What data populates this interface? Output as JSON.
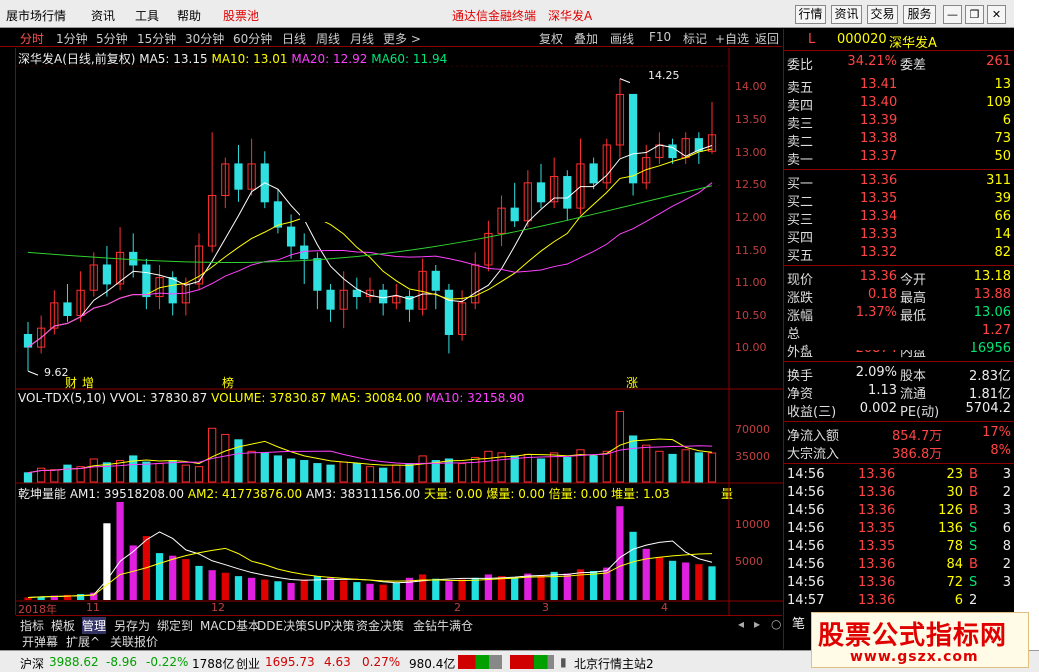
{
  "menubar": {
    "items": [
      "展市场行情",
      "资讯",
      "工具",
      "帮助",
      "股票池"
    ],
    "center_title": "通达信金融终端",
    "stock_title": "深华发A",
    "right_buttons": [
      "行情",
      "资讯",
      "交易",
      "服务"
    ],
    "window_buttons": [
      "minimize",
      "restore",
      "close"
    ]
  },
  "periodbar": {
    "periods": [
      "分时",
      "1分钟",
      "5分钟",
      "15分钟",
      "30分钟",
      "60分钟",
      "日线",
      "周线",
      "月线",
      "更多 >"
    ],
    "active": "分时",
    "tools": [
      "复权",
      "叠加",
      "画线",
      "F10",
      "标记",
      "+自选",
      "返回"
    ]
  },
  "chart_header": {
    "name": "深华发A(日线,前复权)",
    "ma5": "MA5: 13.15",
    "ma10": "MA10: 13.01",
    "ma20": "MA20: 12.92",
    "ma60": "MA60: 11.94",
    "high_label": "14.25",
    "low_label": "9.62",
    "markers": [
      "财",
      "增",
      "榜",
      "涨"
    ]
  },
  "vol_header": {
    "name": "VOL-TDX(5,10)",
    "vvol": "VVOL: 37830.87",
    "volume": "VOLUME: 37830.87",
    "ma5": "MA5: 30084.00",
    "ma10": "MA10: 32158.90"
  },
  "qk_header": {
    "name": "乾坤量能",
    "am1": "AM1: 39518208.00",
    "am2": "AM2: 41773876.00",
    "am3": "AM3: 38311156.00",
    "extra": "天量: 0.00  爆量: 0.00  倍量: 0.00  堆量: 1.03",
    "right_tag": "量"
  },
  "price_axis": [
    "14.00",
    "13.50",
    "13.00",
    "12.50",
    "12.00",
    "11.50",
    "11.00",
    "10.50",
    "10.00"
  ],
  "vol_axis": [
    "70000",
    "35000"
  ],
  "qk_axis": [
    "10000",
    "5000"
  ],
  "date_axis": [
    "2018年",
    "11",
    "12",
    "2",
    "3",
    "4"
  ],
  "chart_data": {
    "type": "candlestick",
    "title": "深华发A(日线,前复权)",
    "price_ylim": [
      9.4,
      14.45
    ],
    "high": 14.25,
    "low": 9.62,
    "ma": {
      "MA5": 13.15,
      "MA10": 13.01,
      "MA20": 12.92,
      "MA60": 11.94
    },
    "candles": [
      {
        "o": 10.2,
        "c": 10.0,
        "h": 10.4,
        "l": 9.62
      },
      {
        "o": 10.0,
        "c": 10.3,
        "h": 10.5,
        "l": 9.9
      },
      {
        "o": 10.3,
        "c": 10.7,
        "h": 10.9,
        "l": 10.2
      },
      {
        "o": 10.7,
        "c": 10.5,
        "h": 11.0,
        "l": 10.4
      },
      {
        "o": 10.5,
        "c": 10.9,
        "h": 11.2,
        "l": 10.4
      },
      {
        "o": 10.9,
        "c": 11.3,
        "h": 11.5,
        "l": 10.8
      },
      {
        "o": 11.3,
        "c": 11.0,
        "h": 11.6,
        "l": 10.8
      },
      {
        "o": 11.0,
        "c": 11.5,
        "h": 11.9,
        "l": 10.9
      },
      {
        "o": 11.5,
        "c": 11.3,
        "h": 11.8,
        "l": 11.1
      },
      {
        "o": 11.3,
        "c": 10.8,
        "h": 11.4,
        "l": 10.6
      },
      {
        "o": 10.8,
        "c": 11.1,
        "h": 11.3,
        "l": 10.6
      },
      {
        "o": 11.1,
        "c": 10.7,
        "h": 11.2,
        "l": 10.5
      },
      {
        "o": 10.7,
        "c": 11.0,
        "h": 11.1,
        "l": 10.5
      },
      {
        "o": 11.0,
        "c": 11.6,
        "h": 11.8,
        "l": 10.9
      },
      {
        "o": 11.6,
        "c": 12.4,
        "h": 13.4,
        "l": 11.5
      },
      {
        "o": 12.4,
        "c": 12.9,
        "h": 13.0,
        "l": 12.2
      },
      {
        "o": 12.9,
        "c": 12.5,
        "h": 13.2,
        "l": 12.3
      },
      {
        "o": 12.5,
        "c": 12.9,
        "h": 13.3,
        "l": 12.4
      },
      {
        "o": 12.9,
        "c": 12.3,
        "h": 13.1,
        "l": 12.2
      },
      {
        "o": 12.3,
        "c": 11.9,
        "h": 12.5,
        "l": 11.8
      },
      {
        "o": 11.9,
        "c": 11.6,
        "h": 12.1,
        "l": 11.4
      },
      {
        "o": 11.6,
        "c": 11.4,
        "h": 11.8,
        "l": 11.0
      },
      {
        "o": 11.4,
        "c": 10.9,
        "h": 11.5,
        "l": 10.6
      },
      {
        "o": 10.9,
        "c": 10.6,
        "h": 11.0,
        "l": 10.4
      },
      {
        "o": 10.6,
        "c": 10.9,
        "h": 11.2,
        "l": 10.3
      },
      {
        "o": 10.9,
        "c": 10.8,
        "h": 11.1,
        "l": 10.6
      },
      {
        "o": 10.8,
        "c": 10.9,
        "h": 11.1,
        "l": 10.7
      },
      {
        "o": 10.9,
        "c": 10.7,
        "h": 11.0,
        "l": 10.5
      },
      {
        "o": 10.7,
        "c": 10.8,
        "h": 11.0,
        "l": 10.6
      },
      {
        "o": 10.8,
        "c": 10.6,
        "h": 10.9,
        "l": 10.4
      },
      {
        "o": 10.6,
        "c": 11.2,
        "h": 11.4,
        "l": 10.5
      },
      {
        "o": 11.2,
        "c": 10.9,
        "h": 11.3,
        "l": 10.6
      },
      {
        "o": 10.9,
        "c": 10.2,
        "h": 11.0,
        "l": 9.9
      },
      {
        "o": 10.2,
        "c": 10.7,
        "h": 10.9,
        "l": 10.1
      },
      {
        "o": 10.7,
        "c": 11.3,
        "h": 11.5,
        "l": 10.6
      },
      {
        "o": 11.3,
        "c": 11.8,
        "h": 12.0,
        "l": 11.2
      },
      {
        "o": 11.8,
        "c": 12.2,
        "h": 12.4,
        "l": 11.6
      },
      {
        "o": 12.2,
        "c": 12.0,
        "h": 12.6,
        "l": 11.9
      },
      {
        "o": 12.0,
        "c": 12.6,
        "h": 12.8,
        "l": 11.9
      },
      {
        "o": 12.6,
        "c": 12.3,
        "h": 12.9,
        "l": 12.2
      },
      {
        "o": 12.3,
        "c": 12.7,
        "h": 13.0,
        "l": 12.2
      },
      {
        "o": 12.7,
        "c": 12.2,
        "h": 12.8,
        "l": 12.0
      },
      {
        "o": 12.2,
        "c": 12.9,
        "h": 13.3,
        "l": 12.1
      },
      {
        "o": 12.9,
        "c": 12.6,
        "h": 13.0,
        "l": 12.5
      },
      {
        "o": 12.6,
        "c": 13.2,
        "h": 13.3,
        "l": 12.5
      },
      {
        "o": 13.2,
        "c": 14.0,
        "h": 14.25,
        "l": 13.0
      },
      {
        "o": 14.0,
        "c": 12.6,
        "h": 14.0,
        "l": 12.4
      },
      {
        "o": 12.6,
        "c": 13.0,
        "h": 13.2,
        "l": 12.5
      },
      {
        "o": 13.0,
        "c": 13.2,
        "h": 13.4,
        "l": 12.9
      },
      {
        "o": 13.2,
        "c": 13.0,
        "h": 13.3,
        "l": 12.9
      },
      {
        "o": 13.0,
        "c": 13.3,
        "h": 13.4,
        "l": 12.9
      },
      {
        "o": 13.3,
        "c": 13.1,
        "h": 13.4,
        "l": 12.9
      },
      {
        "o": 13.1,
        "c": 13.36,
        "h": 13.88,
        "l": 13.06
      }
    ],
    "volume": [
      12,
      18,
      16,
      22,
      20,
      30,
      25,
      28,
      34,
      26,
      24,
      28,
      22,
      20,
      70,
      62,
      55,
      40,
      38,
      34,
      30,
      28,
      24,
      22,
      26,
      24,
      20,
      18,
      22,
      24,
      34,
      28,
      30,
      24,
      32,
      40,
      38,
      34,
      36,
      30,
      38,
      32,
      42,
      34,
      40,
      92,
      60,
      48,
      40,
      36,
      42,
      38,
      37.8
    ],
    "qiankun": [
      300,
      420,
      520,
      600,
      700,
      860,
      9000,
      11500,
      6400,
      7500,
      5500,
      5200,
      4800,
      4000,
      3500,
      3200,
      2800,
      2600,
      2400,
      2200,
      2000,
      2400,
      2800,
      2600,
      2300,
      2100,
      1900,
      1800,
      2000,
      2600,
      3000,
      2500,
      2200,
      2400,
      2600,
      3000,
      2800,
      2600,
      3100,
      2900,
      3300,
      3100,
      3600,
      3400,
      3800,
      11000,
      8000,
      6000,
      5000,
      4600,
      4400,
      4200,
      3951
    ]
  },
  "quote": {
    "code": "000020",
    "name": "深华发A",
    "weibi_label": "委比",
    "weibi": "34.21%",
    "weicha_label": "委差",
    "weicha": "261",
    "asks": [
      {
        "label": "卖五",
        "price": "13.41",
        "vol": "13"
      },
      {
        "label": "卖四",
        "price": "13.40",
        "vol": "109"
      },
      {
        "label": "卖三",
        "price": "13.39",
        "vol": "6"
      },
      {
        "label": "卖二",
        "price": "13.38",
        "vol": "73"
      },
      {
        "label": "卖一",
        "price": "13.37",
        "vol": "50"
      }
    ],
    "bids": [
      {
        "label": "买一",
        "price": "13.36",
        "vol": "311"
      },
      {
        "label": "买二",
        "price": "13.35",
        "vol": "39"
      },
      {
        "label": "买三",
        "price": "13.34",
        "vol": "66"
      },
      {
        "label": "买四",
        "price": "13.33",
        "vol": "14"
      },
      {
        "label": "买五",
        "price": "13.32",
        "vol": "82"
      }
    ],
    "stats": [
      {
        "l": "现价",
        "v": "13.36",
        "l2": "今开",
        "v2": "13.18"
      },
      {
        "l": "涨跌",
        "v": "0.18",
        "l2": "最高",
        "v2": "13.88"
      },
      {
        "l": "涨幅",
        "v": "1.37%",
        "l2": "最低",
        "v2": "13.06"
      },
      {
        "l": "总",
        "v": "",
        "l2": "",
        "v2": "1.27"
      },
      {
        "l": "外盘",
        "v": "20874",
        "l2": "内盘",
        "v2": "16956"
      }
    ],
    "stats2": [
      {
        "l": "换手",
        "v": "2.09%",
        "l2": "股本",
        "v2": "2.83亿"
      },
      {
        "l": "净资",
        "v": "1.13",
        "l2": "流通",
        "v2": "1.81亿"
      },
      {
        "l": "收益(三)",
        "v": "0.002",
        "l2": "PE(动)",
        "v2": "5704.2"
      }
    ],
    "flow": [
      {
        "l": "净流入额",
        "v": "854.7万",
        "p": "17%"
      },
      {
        "l": "大宗流入",
        "v": "386.8万",
        "p": "8%"
      }
    ],
    "ticks": [
      {
        "t": "14:56",
        "p": "13.36",
        "v": "23",
        "d": "B",
        "n": "3"
      },
      {
        "t": "14:56",
        "p": "13.36",
        "v": "30",
        "d": "B",
        "n": "2"
      },
      {
        "t": "14:56",
        "p": "13.36",
        "v": "126",
        "d": "B",
        "n": "3"
      },
      {
        "t": "14:56",
        "p": "13.35",
        "v": "136",
        "d": "S",
        "n": "6"
      },
      {
        "t": "14:56",
        "p": "13.35",
        "v": "78",
        "d": "S",
        "n": "8"
      },
      {
        "t": "14:56",
        "p": "13.36",
        "v": "84",
        "d": "B",
        "n": "2"
      },
      {
        "t": "14:56",
        "p": "13.36",
        "v": "72",
        "d": "S",
        "n": "3"
      },
      {
        "t": "14:57",
        "p": "13.36",
        "v": "6",
        "d": "2",
        "n": ""
      }
    ],
    "footer_label": "笔"
  },
  "bottomtabs": [
    "指标",
    "模板",
    "管理",
    "另存为",
    "绑定到",
    "MACD基本",
    "DDE决策",
    "SUP决策",
    "资金决策",
    "金钻牛满仓"
  ],
  "bottomtabs2": [
    "开弹幕",
    "扩展^",
    "关联报价"
  ],
  "statusbar": {
    "idx1_name": "沪深",
    "idx1_val": "3988.62",
    "idx1_chg": "-8.96",
    "idx1_pct": "-0.22%",
    "idx1_amt": "1788亿",
    "idx2_name": "创业",
    "idx2_val": "1695.73",
    "idx2_chg": "4.63",
    "idx2_pct": "0.27%",
    "idx2_amt": "980.4亿",
    "server": "北京行情主站2"
  },
  "watermark": {
    "title": "股票公式指标网",
    "url": "www.gszx.com"
  },
  "colors": {
    "up": "#ff3030",
    "down": "#30e0e0",
    "ma5": "#ffffff",
    "ma10": "#ffff00",
    "ma20": "#ff40ff",
    "ma60": "#30d030"
  }
}
